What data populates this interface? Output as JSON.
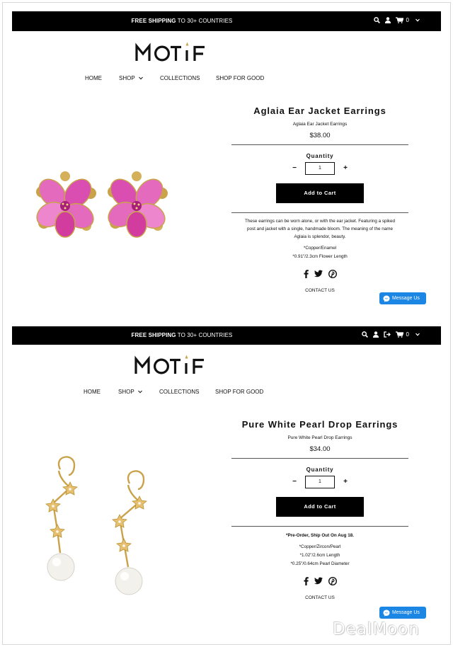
{
  "colors": {
    "topbar": "#000000",
    "accent_gold": "#c9a24a",
    "petal_pink": "#e05fb6",
    "messenger_blue": "#1c86e4"
  },
  "panels": [
    {
      "topbar": {
        "promo_bold": "FREE SHIPPING",
        "promo_rest": " TO 30+ COUNTRIES",
        "cart_count": "0",
        "icons": [
          "search-icon",
          "user-icon",
          "cart-icon",
          "chevron-down-icon"
        ]
      },
      "brand": "MOTIF",
      "nav": {
        "home": "HOME",
        "shop": "SHOP",
        "collections": "COLLECTIONS",
        "shop_for_good": "SHOP FOR GOOD"
      },
      "product": {
        "title": "Aglaia Ear Jacket Earrings",
        "subtitle": "Aglaia Ear Jacket Earrings",
        "price": "$38.00",
        "quantity_label": "Quantity",
        "quantity": "1",
        "minus": "−",
        "plus": "+",
        "add_to_cart": "Add to Cart",
        "description_lines": [
          "These earrings can be worn alone, or with the ear jacket. Featuring a spiked",
          "post and jacket with a single, handmade bloom. The meaning of the name",
          "Aglaia is splendor, beauty."
        ],
        "specs": [
          "*Copper/Enamel",
          "*0.91\"/2.3cm Flower Length"
        ],
        "contact": "CONTACT US",
        "message_us": "Message Us",
        "image_icon": "flower-earrings-image"
      }
    },
    {
      "topbar": {
        "promo_bold": "FREE SHIPPING",
        "promo_rest": " TO 30+ COUNTRIES",
        "cart_count": "0",
        "icons": [
          "search-icon",
          "user-icon",
          "sign-out-icon",
          "cart-icon",
          "chevron-down-icon"
        ]
      },
      "brand": "MOTIF",
      "nav": {
        "home": "HOME",
        "shop": "SHOP",
        "collections": "COLLECTIONS",
        "shop_for_good": "SHOP FOR GOOD"
      },
      "product": {
        "title": "Pure White Pearl Drop Earrings",
        "subtitle": "Pure White Pearl Drop Earrings",
        "price": "$34.00",
        "quantity_label": "Quantity",
        "quantity": "1",
        "minus": "−",
        "plus": "+",
        "add_to_cart": "Add to Cart",
        "preorder": "*Pre-Order, Ship Out On Aug 18.",
        "specs": [
          "*Copper/Zircon/Pearl",
          "*1.02\"/2.6cm Length",
          "*0.25\"/0.64cm Pearl Diameter"
        ],
        "contact": "CONTACT US",
        "message_us": "Message Us",
        "image_icon": "pearl-drop-earrings-image"
      }
    }
  ],
  "watermark": "DealMoon"
}
